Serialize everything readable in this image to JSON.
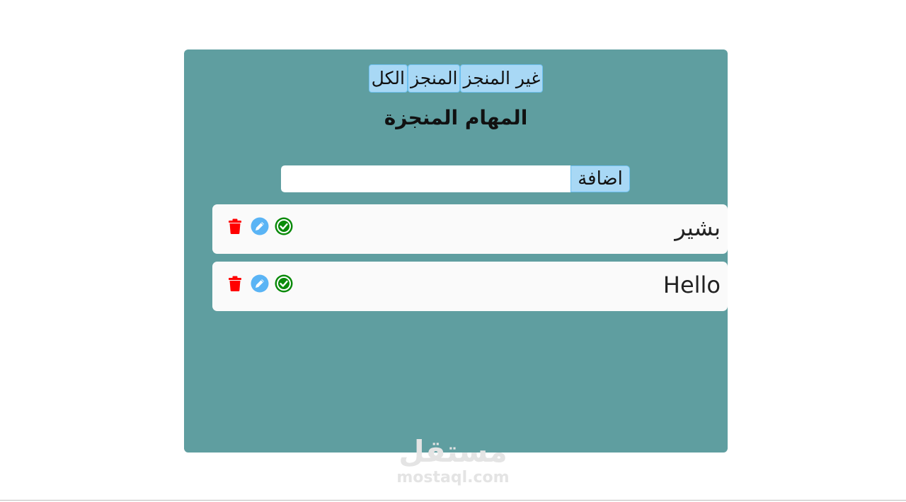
{
  "filters": {
    "not_done_label": "غير المنجز",
    "done_label": "المنجز",
    "all_label": "الكل"
  },
  "title": "المهام المنجزة",
  "add": {
    "button_label": "اضافة",
    "input_value": ""
  },
  "tasks": [
    {
      "text": "بشير"
    },
    {
      "text": "Hello"
    }
  ],
  "icons": {
    "delete": "trash-icon",
    "edit": "pencil-icon",
    "complete": "check-circle-icon"
  },
  "colors": {
    "card_background": "#5f9ea0",
    "button_background": "#a8d8f5",
    "delete_icon": "#ff0000",
    "edit_icon": "#5ab4f5",
    "check_icon": "#0a8a0a"
  },
  "watermark": {
    "arabic": "مستقل",
    "latin": "mostaql.com"
  }
}
